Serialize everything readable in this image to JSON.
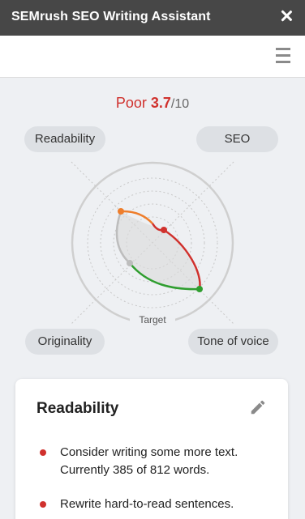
{
  "window": {
    "title": "SEMrush SEO Writing Assistant",
    "close_icon": "close-icon"
  },
  "toolbar": {
    "menu_icon": "hamburger-menu-icon"
  },
  "score": {
    "rating": "Poor",
    "value": "3.7",
    "max": "/10"
  },
  "radar": {
    "center_label": "Target",
    "axes": {
      "readability": "Readability",
      "seo": "SEO",
      "originality": "Originality",
      "tone": "Tone of voice"
    },
    "colors": {
      "readability": "#ee7d2b",
      "seo": "#d0312d",
      "tone": "#2f9e2f",
      "originality": "#b5b5b5"
    }
  },
  "card": {
    "title": "Readability",
    "edit_icon": "pencil-icon",
    "issues": [
      {
        "text": "Consider writing some more text. Currently 385 of 812 words."
      },
      {
        "text": "Rewrite hard-to-read sentences."
      }
    ]
  }
}
